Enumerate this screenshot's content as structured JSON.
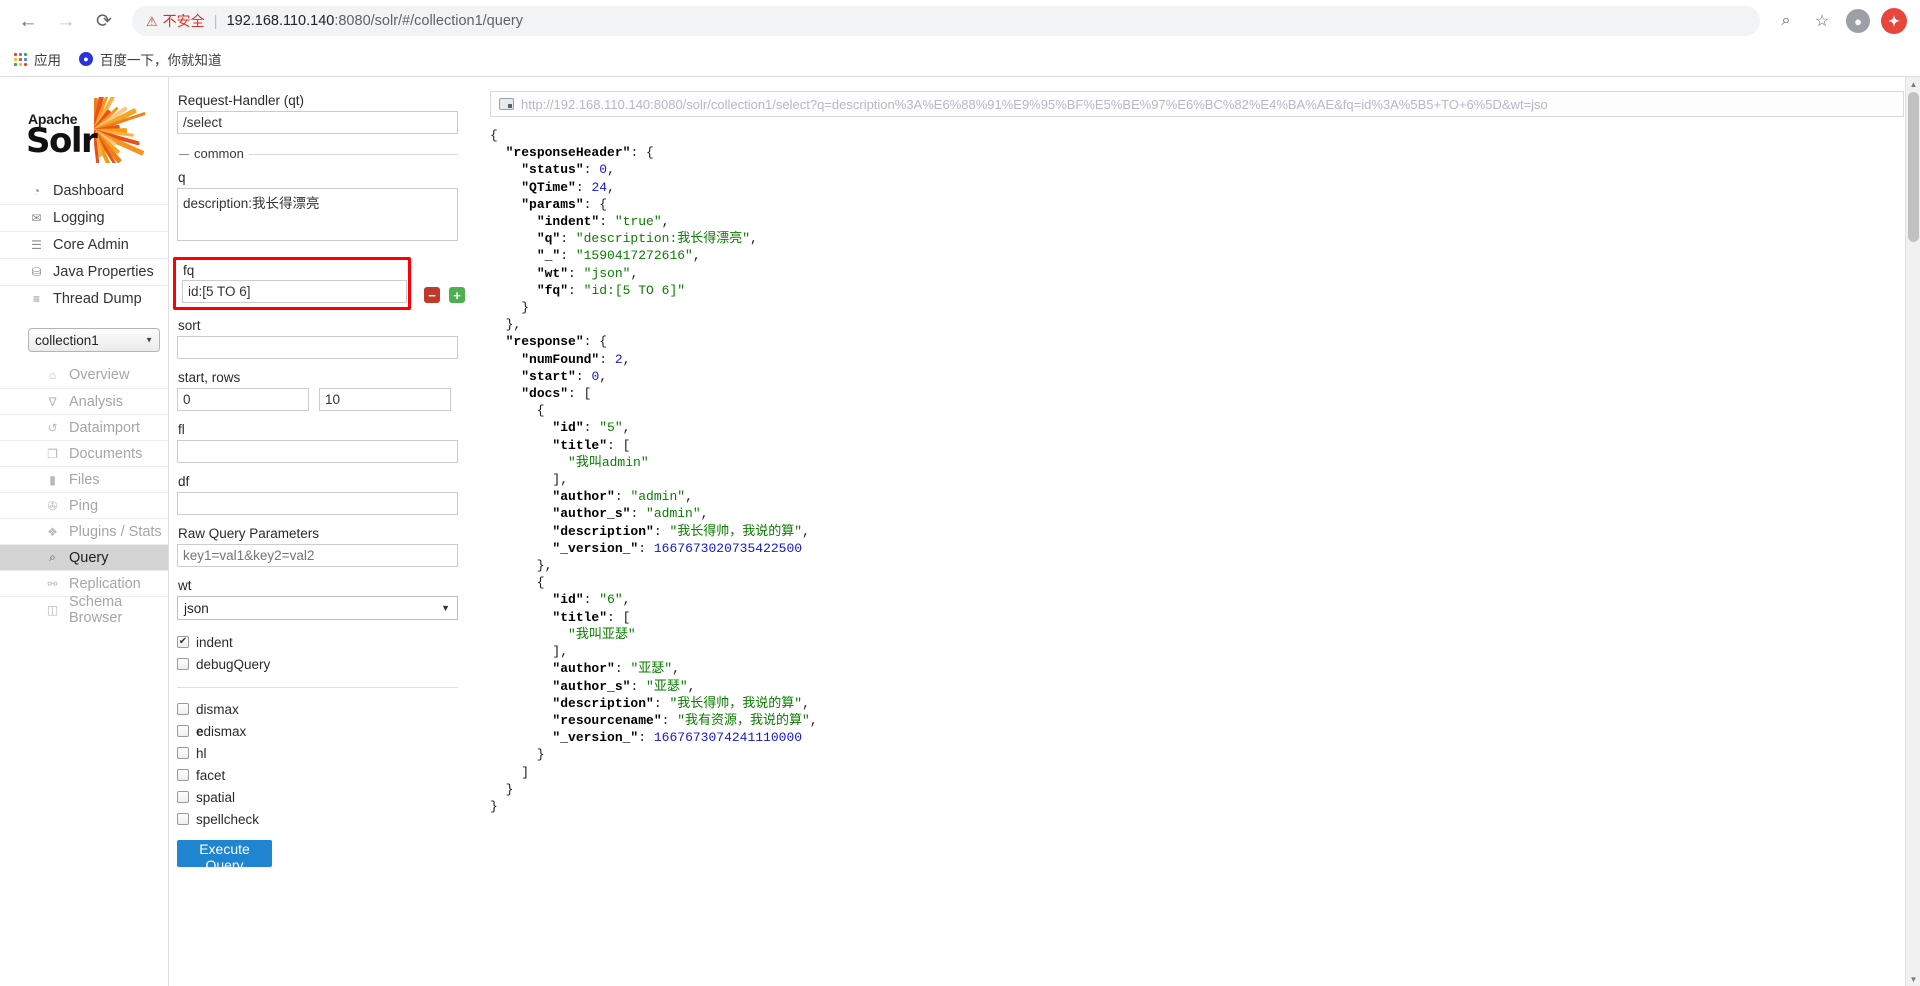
{
  "browser": {
    "back_icon": "←",
    "forward_icon": "→",
    "reload_icon": "⟳",
    "warning_icon": "⚠",
    "insecure_label": "不安全",
    "separator": "|",
    "url_host": "192.168.110.140",
    "url_rest": ":8080/solr/#/collection1/query",
    "zoom_icon": "⌕",
    "star_icon": "☆",
    "profile_icon": "●",
    "extension_icon": "✹",
    "bookmarks": [
      {
        "label": "应用",
        "icon": "apps-grid-icon"
      },
      {
        "label": "百度一下，你就知道",
        "icon": "baidu-icon"
      }
    ]
  },
  "sidebar": {
    "logo": {
      "apache": "Apache",
      "solr": "Solr"
    },
    "top_items": [
      {
        "label": "Dashboard",
        "icon": "dashboard-icon",
        "glyph": "◔"
      },
      {
        "label": "Logging",
        "icon": "logging-icon",
        "glyph": "✉"
      },
      {
        "label": "Core Admin",
        "icon": "core-admin-icon",
        "glyph": "☰"
      },
      {
        "label": "Java Properties",
        "icon": "java-properties-icon",
        "glyph": "⛁"
      },
      {
        "label": "Thread Dump",
        "icon": "thread-dump-icon",
        "glyph": "≡"
      }
    ],
    "collection_select": {
      "value": "collection1",
      "caret": "▼"
    },
    "core_items": [
      {
        "label": "Overview",
        "icon": "overview-icon",
        "glyph": "⌂",
        "active": false
      },
      {
        "label": "Analysis",
        "icon": "analysis-icon",
        "glyph": "∇",
        "active": false
      },
      {
        "label": "Dataimport",
        "icon": "dataimport-icon",
        "glyph": "↺",
        "active": false
      },
      {
        "label": "Documents",
        "icon": "documents-icon",
        "glyph": "❐",
        "active": false
      },
      {
        "label": "Files",
        "icon": "files-icon",
        "glyph": "▮",
        "active": false
      },
      {
        "label": "Ping",
        "icon": "ping-icon",
        "glyph": "✇",
        "active": false
      },
      {
        "label": "Plugins / Stats",
        "icon": "plugins-stats-icon",
        "glyph": "❖",
        "active": false
      },
      {
        "label": "Query",
        "icon": "query-icon",
        "glyph": "⌕",
        "active": true
      },
      {
        "label": "Replication",
        "icon": "replication-icon",
        "glyph": "⚯",
        "active": false
      },
      {
        "label": "Schema Browser",
        "icon": "schema-browser-icon",
        "glyph": "◫",
        "active": false
      }
    ]
  },
  "query_form": {
    "request_handler_label": "Request-Handler (qt)",
    "request_handler_value": "/select",
    "common_legend": "common",
    "common_dash": "—",
    "q_label": "q",
    "q_value": "description:我长得漂亮",
    "fq_label": "fq",
    "fq_value": "id:[5 TO 6]",
    "fq_remove": "−",
    "fq_add": "+",
    "sort_label": "sort",
    "sort_value": "",
    "start_rows_label": "start, rows",
    "start_value": "0",
    "rows_value": "10",
    "fl_label": "fl",
    "fl_value": "",
    "df_label": "df",
    "df_value": "",
    "raw_query_label": "Raw Query Parameters",
    "raw_query_placeholder": "key1=val1&key2=val2",
    "wt_label": "wt",
    "wt_value": "json",
    "wt_caret": "▼",
    "checkmark": "✔",
    "checkboxes_primary": [
      {
        "label": "indent",
        "checked": true
      },
      {
        "label": "debugQuery",
        "checked": false
      }
    ],
    "checkboxes_secondary": [
      {
        "label": "dismax",
        "checked": false
      },
      {
        "label": "edismax",
        "checked": false
      },
      {
        "label": "hl",
        "checked": false
      },
      {
        "label": "facet",
        "checked": false
      },
      {
        "label": "spatial",
        "checked": false
      },
      {
        "label": "spellcheck",
        "checked": false
      }
    ],
    "execute_label": "Execute Query"
  },
  "result": {
    "url": "http://192.168.110.140:8080/solr/collection1/select?q=description%3A%E6%88%91%E9%95%BF%E5%BE%97%E6%BC%82%E4%BA%AE&fq=id%3A%5B5+TO+6%5D&wt=jso",
    "json_text": "{\n  \"responseHeader\": {\n    \"status\": 0,\n    \"QTime\": 24,\n    \"params\": {\n      \"indent\": \"true\",\n      \"q\": \"description:我长得漂亮\",\n      \"_\": \"1590417272616\",\n      \"wt\": \"json\",\n      \"fq\": \"id:[5 TO 6]\"\n    }\n  },\n  \"response\": {\n    \"numFound\": 2,\n    \"start\": 0,\n    \"docs\": [\n      {\n        \"id\": \"5\",\n        \"title\": [\n          \"我叫admin\"\n        ],\n        \"author\": \"admin\",\n        \"author_s\": \"admin\",\n        \"description\": \"我长得帅，我说的算\",\n        \"_version_\": 1667673020735422500\n      },\n      {\n        \"id\": \"6\",\n        \"title\": [\n          \"我叫亚瑟\"\n        ],\n        \"author\": \"亚瑟\",\n        \"author_s\": \"亚瑟\",\n        \"description\": \"我长得帅，我说的算\",\n        \"resourcename\": \"我有资源，我说的算\",\n        \"_version_\": 1667673074241110000\n      }\n    ]\n  }\n}"
  },
  "scrollbar": {
    "up_arrow": "▲",
    "down_arrow": "▼"
  },
  "colors": {
    "accent_blue": "#1f85d0",
    "insecure_red": "#d93025",
    "highlight_red": "#ff0000",
    "active_nav": "#d4d4d4",
    "json_string": "#0a7d00",
    "json_number": "#1515d6"
  }
}
